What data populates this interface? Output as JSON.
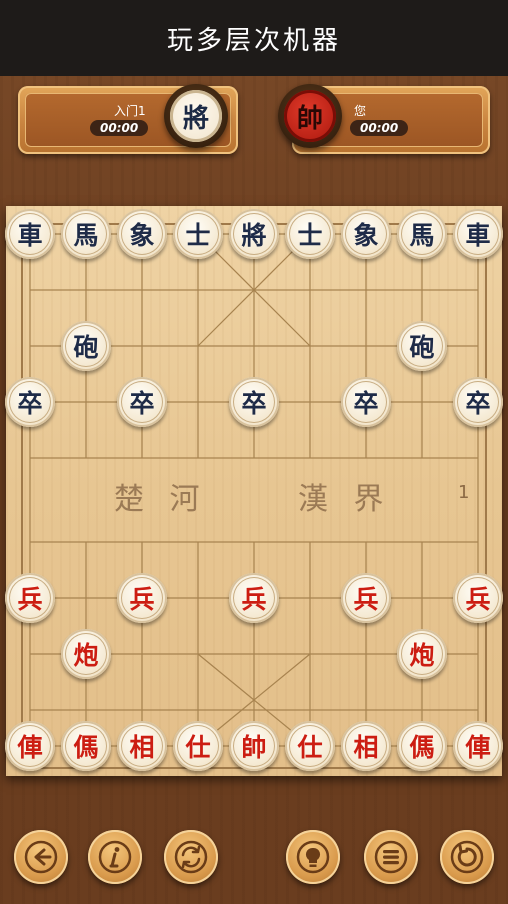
{
  "header": {
    "title": "玩多层次机器"
  },
  "players": {
    "opponent": {
      "name": "入门1",
      "time": "00:00",
      "avatar_char": "將"
    },
    "self": {
      "name": "您",
      "time": "00:00",
      "avatar_char": "帥"
    }
  },
  "board": {
    "river_left": "楚 河",
    "river_right": "漢 界",
    "move_count": "1",
    "black_pieces": [
      {
        "char": "車",
        "col": 0,
        "row": 0
      },
      {
        "char": "馬",
        "col": 1,
        "row": 0
      },
      {
        "char": "象",
        "col": 2,
        "row": 0
      },
      {
        "char": "士",
        "col": 3,
        "row": 0
      },
      {
        "char": "將",
        "col": 4,
        "row": 0
      },
      {
        "char": "士",
        "col": 5,
        "row": 0
      },
      {
        "char": "象",
        "col": 6,
        "row": 0
      },
      {
        "char": "馬",
        "col": 7,
        "row": 0
      },
      {
        "char": "車",
        "col": 8,
        "row": 0
      },
      {
        "char": "砲",
        "col": 1,
        "row": 2
      },
      {
        "char": "砲",
        "col": 7,
        "row": 2
      },
      {
        "char": "卒",
        "col": 0,
        "row": 3
      },
      {
        "char": "卒",
        "col": 2,
        "row": 3
      },
      {
        "char": "卒",
        "col": 4,
        "row": 3
      },
      {
        "char": "卒",
        "col": 6,
        "row": 3
      },
      {
        "char": "卒",
        "col": 8,
        "row": 3
      }
    ],
    "red_pieces": [
      {
        "char": "兵",
        "col": 0,
        "row": 6
      },
      {
        "char": "兵",
        "col": 2,
        "row": 6
      },
      {
        "char": "兵",
        "col": 4,
        "row": 6
      },
      {
        "char": "兵",
        "col": 6,
        "row": 6
      },
      {
        "char": "兵",
        "col": 8,
        "row": 6
      },
      {
        "char": "炮",
        "col": 1,
        "row": 7
      },
      {
        "char": "炮",
        "col": 7,
        "row": 7
      },
      {
        "char": "俥",
        "col": 0,
        "row": 9
      },
      {
        "char": "傌",
        "col": 1,
        "row": 9
      },
      {
        "char": "相",
        "col": 2,
        "row": 9
      },
      {
        "char": "仕",
        "col": 3,
        "row": 9
      },
      {
        "char": "帥",
        "col": 4,
        "row": 9
      },
      {
        "char": "仕",
        "col": 5,
        "row": 9
      },
      {
        "char": "相",
        "col": 6,
        "row": 9
      },
      {
        "char": "傌",
        "col": 7,
        "row": 9
      },
      {
        "char": "俥",
        "col": 8,
        "row": 9
      }
    ]
  },
  "toolbar": [
    {
      "icon": "back-arrow-icon"
    },
    {
      "icon": "info-icon"
    },
    {
      "icon": "swap-icon"
    },
    {
      "icon": "lightbulb-icon"
    },
    {
      "icon": "menu-icon"
    },
    {
      "icon": "undo-icon"
    }
  ],
  "colors": {
    "black_piece": "#1e2b48",
    "red_piece": "#cc1d12",
    "board": "#e7c692",
    "header_bg": "#1e1b19"
  }
}
